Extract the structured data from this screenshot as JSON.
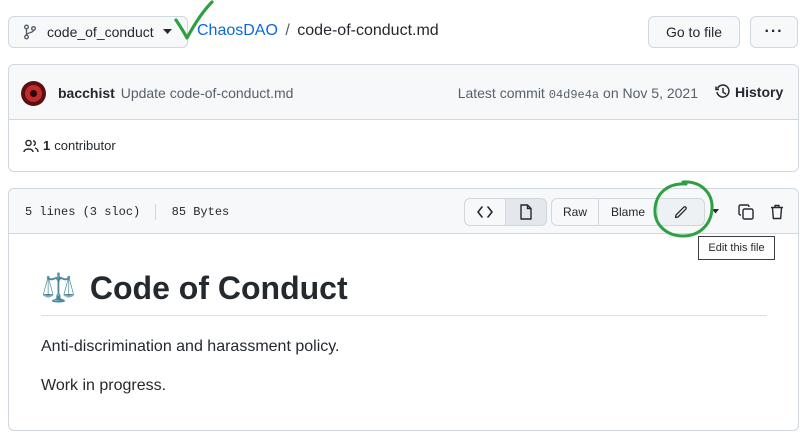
{
  "branch": {
    "name": "code_of_conduct"
  },
  "breadcrumb": {
    "repo": "ChaosDAO",
    "separator": "/",
    "file": "code-of-conduct.md"
  },
  "actions": {
    "go_to_file": "Go to file",
    "more": "···"
  },
  "commit": {
    "author": "bacchist",
    "message": "Update code-of-conduct.md",
    "latest_label": "Latest commit",
    "sha": "04d9e4a",
    "date_text": "on Nov 5, 2021",
    "history_label": "History"
  },
  "contributors": {
    "count": "1",
    "label": "contributor"
  },
  "file_info": {
    "lines": "5 lines (3 sloc)",
    "size": "85 Bytes"
  },
  "toolbar": {
    "raw": "Raw",
    "blame": "Blame",
    "tooltip": "Edit this file"
  },
  "content": {
    "emoji": "⚖️",
    "heading": "Code of Conduct",
    "paragraphs": [
      "Anti-discrimination and harassment policy.",
      "Work in progress."
    ]
  },
  "colors": {
    "link": "#0969da",
    "annotation_green": "#2ea043",
    "border": "#d0d7de"
  },
  "icons": [
    "git-branch-icon",
    "caret-down-icon",
    "check-mark-annotation",
    "clock-history-icon",
    "people-icon",
    "code-icon",
    "file-icon",
    "pencil-icon",
    "copy-icon",
    "trash-icon",
    "kebab-icon"
  ]
}
